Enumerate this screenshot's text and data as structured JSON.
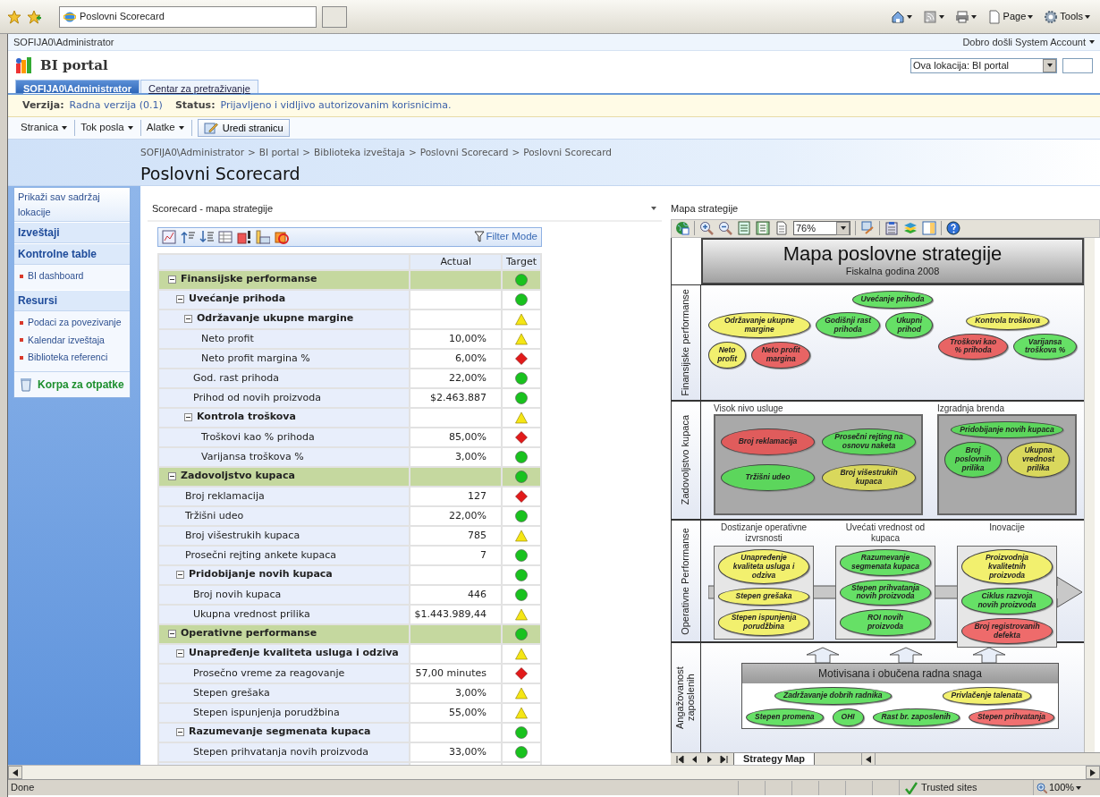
{
  "browser": {
    "tab_title": "Poslovni Scorecard",
    "commands": [
      "Page",
      "Tools"
    ]
  },
  "site": {
    "user": "SOFIJA0\\Administrator",
    "welcome": "Dobro došli System Account",
    "title": "BI portal",
    "scope": "Ova lokacija: BI portal"
  },
  "top_tabs": [
    {
      "label": "SOFIJA0\\Administrator",
      "selected": true
    },
    {
      "label": "Centar za pretraživanje",
      "selected": false
    }
  ],
  "status_line": {
    "version_label": "Verzija:",
    "version": "Radna verzija (0.1)",
    "status_label": "Status:",
    "status": "Prijavljeno i vidljivo autorizovanim korisnicima."
  },
  "toolbar": {
    "menus": [
      "Stranica",
      "Tok posla",
      "Alatke"
    ],
    "edit_button": "Uredi stranicu"
  },
  "breadcrumb": {
    "separator": ">",
    "items": [
      "SOFIJA0\\Administrator",
      "BI portal",
      "Biblioteka izveštaja",
      "Poslovni Scorecard",
      "Poslovni Scorecard"
    ]
  },
  "page_title": "Poslovni Scorecard",
  "quick_launch": {
    "view_all": "Prikaži sav sadržaj lokacije",
    "sections": [
      {
        "heading": "Izveštaji"
      },
      {
        "heading": "Kontrolne table",
        "items": [
          "BI dashboard"
        ]
      },
      {
        "heading": "Resursi",
        "items": [
          "Podaci za povezivanje",
          "Kalendar izveštaja",
          "Biblioteka referenci"
        ]
      }
    ],
    "recycle_bin": "Korpa za otpatke"
  },
  "scorecard": {
    "title": "Scorecard - mapa strategije",
    "filter_mode": "Filter Mode",
    "columns": [
      "Actual",
      "Target"
    ],
    "rows": [
      {
        "label": "Finansijske performanse",
        "indicator": {
          "kind": "circle",
          "color": "#19c21e"
        },
        "expanded": true,
        "children": [
          {
            "label": "Uvećanje prihoda",
            "indicator": {
              "kind": "circle",
              "color": "#19c21e"
            },
            "expanded": true,
            "children": [
              {
                "label": "Održavanje ukupne margine",
                "indicator": {
                  "kind": "triangle",
                  "color": "#f5e614"
                },
                "expanded": true,
                "children": [
                  {
                    "label": "Neto profit",
                    "actual": "10,00%",
                    "indicator": {
                      "kind": "triangle",
                      "color": "#f5e614"
                    }
                  },
                  {
                    "label": "Neto profit margina %",
                    "actual": "6,00%",
                    "indicator": {
                      "kind": "diamond",
                      "color": "#e21a1a"
                    }
                  }
                ]
              },
              {
                "label": "God. rast prihoda",
                "actual": "22,00%",
                "indicator": {
                  "kind": "circle",
                  "color": "#19c21e"
                }
              },
              {
                "label": "Prihod od novih proizvoda",
                "actual": "$2.463.887",
                "indicator": {
                  "kind": "circle",
                  "color": "#19c21e"
                }
              },
              {
                "label": "Kontrola troškova",
                "indicator": {
                  "kind": "triangle",
                  "color": "#f5e614"
                },
                "expanded": true,
                "children": [
                  {
                    "label": "Troškovi kao % prihoda",
                    "actual": "85,00%",
                    "indicator": {
                      "kind": "diamond",
                      "color": "#e21a1a"
                    }
                  },
                  {
                    "label": "Varijansa troškova %",
                    "actual": "3,00%",
                    "indicator": {
                      "kind": "circle",
                      "color": "#19c21e"
                    }
                  }
                ]
              }
            ]
          }
        ]
      },
      {
        "label": "Zadovoljstvo kupaca",
        "indicator": {
          "kind": "circle",
          "color": "#19c21e"
        },
        "expanded": true,
        "children": [
          {
            "label": "Broj reklamacija",
            "actual": "127",
            "indicator": {
              "kind": "diamond",
              "color": "#e21a1a"
            }
          },
          {
            "label": "Tržišni udeo",
            "actual": "22,00%",
            "indicator": {
              "kind": "circle",
              "color": "#19c21e"
            }
          },
          {
            "label": "Broj višestrukih kupaca",
            "actual": "785",
            "indicator": {
              "kind": "triangle",
              "color": "#f5e614"
            }
          },
          {
            "label": "Prosečni rejting ankete kupaca",
            "actual": "7",
            "indicator": {
              "kind": "circle",
              "color": "#19c21e"
            }
          },
          {
            "label": "Pridobijanje novih kupaca",
            "indicator": {
              "kind": "circle",
              "color": "#19c21e"
            },
            "expanded": true,
            "children": [
              {
                "label": "Broj novih kupaca",
                "actual": "446",
                "indicator": {
                  "kind": "circle",
                  "color": "#19c21e"
                }
              },
              {
                "label": "Ukupna vrednost prilika",
                "actual": "$1.443.989,44",
                "indicator": {
                  "kind": "triangle",
                  "color": "#f5e614"
                }
              }
            ]
          }
        ]
      },
      {
        "label": "Operativne performanse",
        "indicator": {
          "kind": "circle",
          "color": "#19c21e"
        },
        "expanded": true,
        "children": [
          {
            "label": "Unapređenje kvaliteta usluga i odziva",
            "indicator": {
              "kind": "triangle",
              "color": "#f5e614"
            },
            "expanded": true,
            "children": [
              {
                "label": "Prosečno vreme za reagovanje",
                "actual": "57,00 minutes",
                "indicator": {
                  "kind": "diamond",
                  "color": "#e21a1a"
                }
              },
              {
                "label": "Stepen grešaka",
                "actual": "3,00%",
                "indicator": {
                  "kind": "triangle",
                  "color": "#f5e614"
                }
              },
              {
                "label": "Stepen ispunjenja porudžbina",
                "actual": "55,00%",
                "indicator": {
                  "kind": "triangle",
                  "color": "#f5e614"
                }
              }
            ]
          },
          {
            "label": "Razumevanje segmenata kupaca",
            "indicator": {
              "kind": "circle",
              "color": "#19c21e"
            },
            "expanded": true,
            "children": [
              {
                "label": "Stepen prihvatanja novih proizvoda",
                "actual": "33,00%",
                "indicator": {
                  "kind": "circle",
                  "color": "#19c21e"
                }
              }
            ]
          }
        ]
      }
    ]
  },
  "strategy_map": {
    "title": "Mapa strategije",
    "zoom": "76%",
    "map_title": "Mapa poslovne strategije",
    "subtitle": "Fiskalna godina 2008",
    "sheet_tab": "Strategy Map",
    "finance": {
      "label": "Finansijske performanse",
      "root": {
        "text": "Uvećanje prihoda",
        "color": "#66e066",
        "children": [
          {
            "text": "Održavanje ukupne margine",
            "color": "#f2f06e",
            "children": [
              {
                "text": "Neto profit",
                "color": "#f2f06e"
              },
              {
                "text": "Neto profit margina",
                "color": "#e86464"
              }
            ]
          },
          {
            "text": "Godišnji rast prihoda",
            "color": "#66e066"
          },
          {
            "text": "Ukupni prihod",
            "color": "#66e066"
          },
          {
            "text": "Kontrola troškova",
            "color": "#f2f06e",
            "children": [
              {
                "text": "Troškovi kao % prihoda",
                "color": "#e86464"
              },
              {
                "text": "Varijansa troškova %",
                "color": "#66e066"
              }
            ]
          }
        ]
      }
    },
    "customers": {
      "label": "Zadovoljstvo kupaca",
      "groups": [
        {
          "title": "Visok nivo usluge",
          "nodes": [
            {
              "text": "Broj reklamacija",
              "color": "#e05c5c"
            },
            {
              "text": "Prosečni rejting na osnovu naketa",
              "color": "#5cd65c"
            },
            {
              "text": "Tržišni udeo",
              "color": "#5cd65c"
            },
            {
              "text": "Broj višestrukih kupaca",
              "color": "#d9d85c"
            }
          ]
        },
        {
          "title": "Izgradnja brenda",
          "root": {
            "text": "Pridobijanje novih kupaca",
            "color": "#5cd65c",
            "children": [
              {
                "text": "Broj poslovnih prilika",
                "color": "#5cd65c"
              },
              {
                "text": "Ukupna vrednost prilika",
                "color": "#d9d85c"
              }
            ]
          }
        }
      ]
    },
    "operations": {
      "label": "Operativne Performanse",
      "groups": [
        {
          "title": "Dostizanje operativne izvrsnosti",
          "nodes": [
            {
              "text": "Unapređenje kvaliteta usluga i odziva",
              "color": "#f2f06e"
            },
            {
              "text": "Stepen grešaka",
              "color": "#f2f06e"
            },
            {
              "text": "Stepen ispunjenja porudžbina",
              "color": "#f2f06e"
            }
          ]
        },
        {
          "title": "Uvećati vrednost od kupaca",
          "nodes": [
            {
              "text": "Razumevanje segmenata kupaca",
              "color": "#66e066"
            },
            {
              "text": "Stepen prihvatanja novih proizvoda",
              "color": "#66e066"
            },
            {
              "text": "ROI novih proizvoda",
              "color": "#66e066"
            }
          ]
        },
        {
          "title": "Inovacije",
          "nodes": [
            {
              "text": "Proizvodnja kvalitetnih proizvoda",
              "color": "#f2f06e"
            },
            {
              "text": "Ciklus razvoja novih proizvoda",
              "color": "#66e066"
            },
            {
              "text": "Broj registrovanih defekta",
              "color": "#ee6b6b"
            }
          ]
        }
      ]
    },
    "employees": {
      "label": "Angažovanost zaposlenih",
      "header": "Motivisana i obučena radna snaga",
      "node_rows": [
        {
          "nodes": [
            {
              "text": "Zadržavanje dobrih radnika",
              "color": "#66e066"
            },
            {
              "text": "Privlačenje talenata",
              "color": "#f2f06e"
            }
          ]
        },
        {
          "nodes": [
            {
              "text": "Stepen promena",
              "color": "#66e066"
            },
            {
              "text": "OHI",
              "color": "#66e066"
            },
            {
              "text": "Rast br. zaposlenih",
              "color": "#66e066"
            },
            {
              "text": "Stepen prihvatanja",
              "color": "#f07070"
            }
          ]
        }
      ]
    }
  },
  "status_bar": {
    "text": "Done",
    "zone": "Trusted sites",
    "zoom": "100%"
  }
}
